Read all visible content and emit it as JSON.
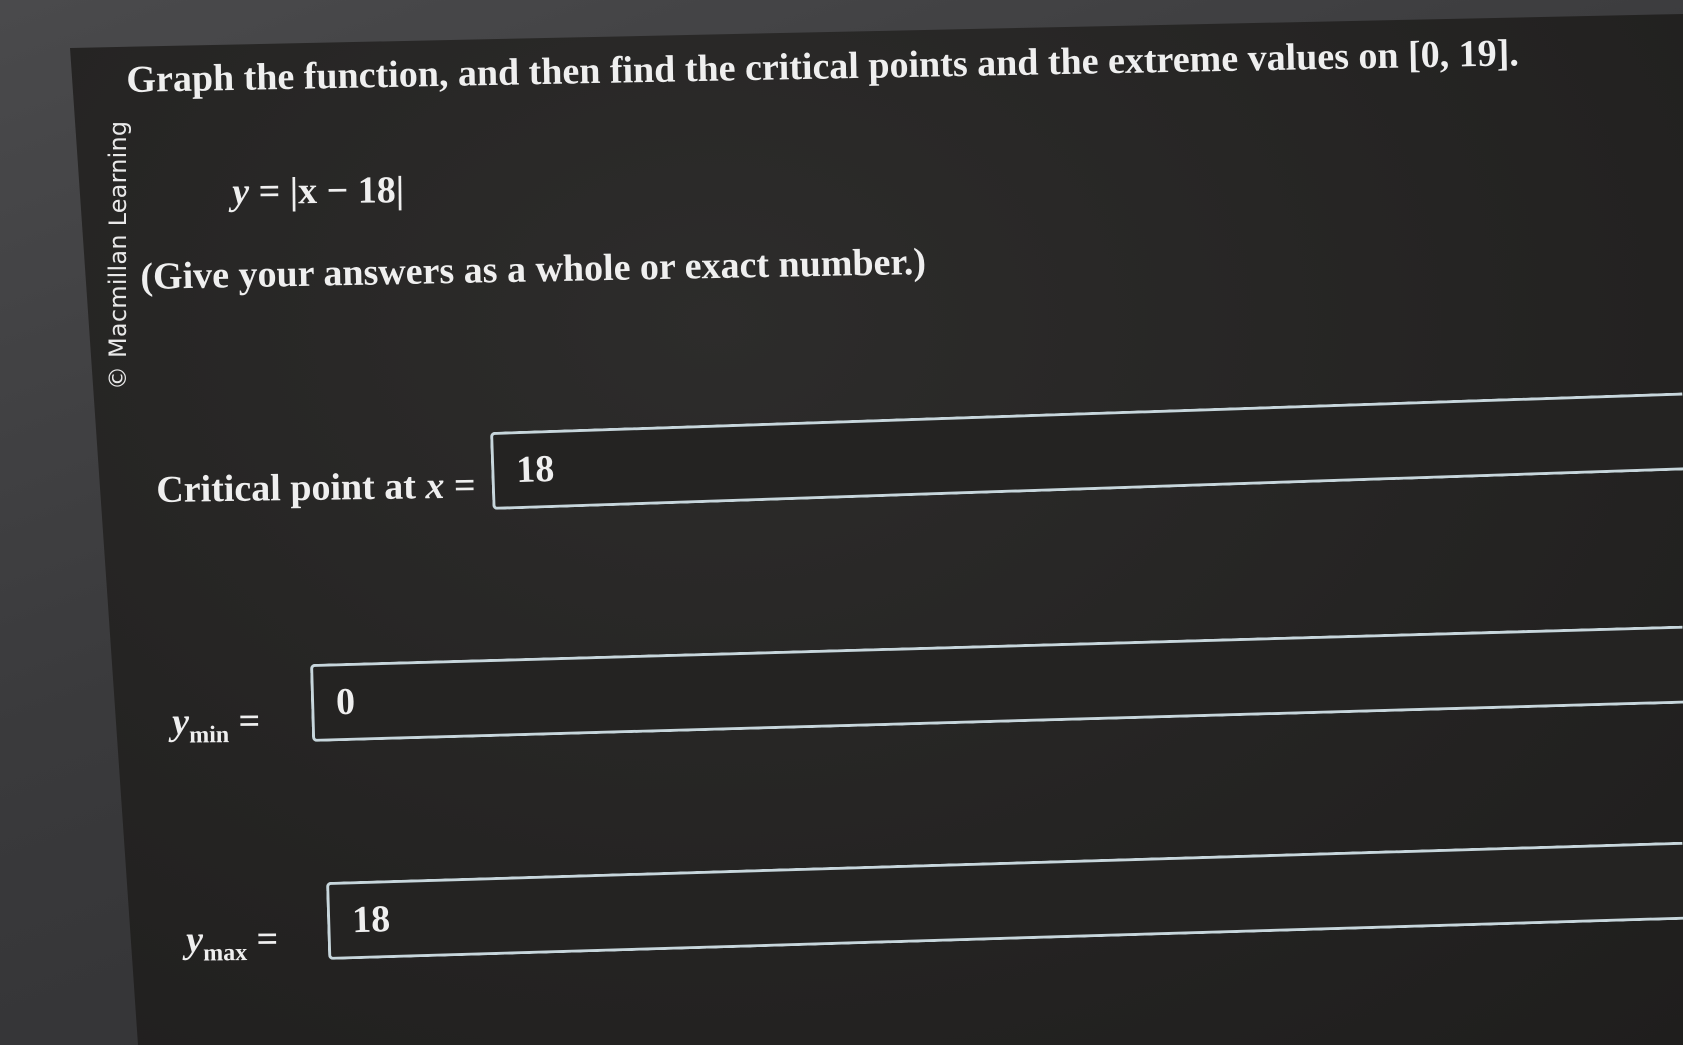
{
  "watermark": "© Macmillan Learning",
  "question": {
    "prompt": "Graph the function, and then find the critical points and the extreme values on [0, 19].",
    "equation_lhs": "y",
    "equation_rhs": "= |x − 18|",
    "instruction": "(Give your answers as a whole or exact number.)"
  },
  "answers": {
    "critical_point": {
      "label": "Critical point at ",
      "variable": "x",
      "equals": " =",
      "value": "18"
    },
    "y_min": {
      "label": "y",
      "subscript": "min",
      "equals": " =",
      "value": "0"
    },
    "y_max": {
      "label": "y",
      "subscript": "max",
      "equals": " =",
      "value": "18"
    }
  }
}
